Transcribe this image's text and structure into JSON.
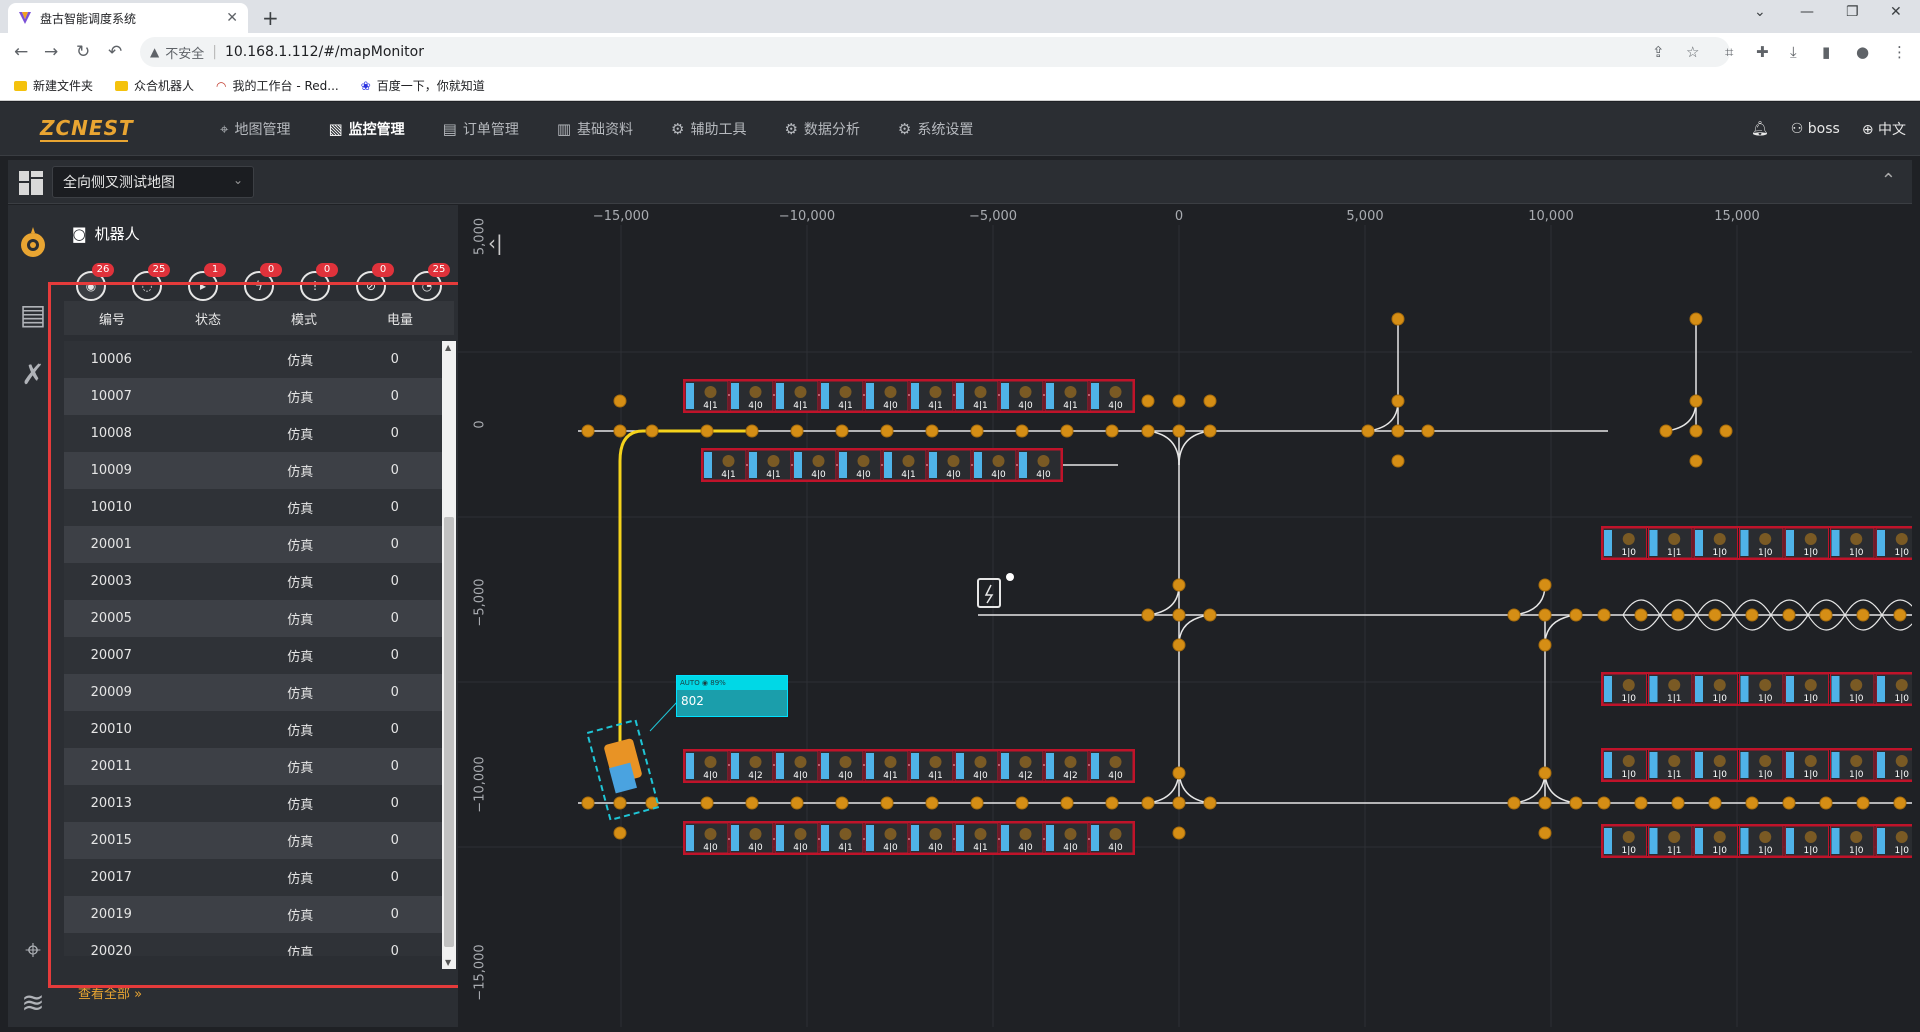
{
  "browser": {
    "tab_title": "盘古智能调度系统",
    "address_insecure": "不安全",
    "address_url": "10.168.1.112/#/mapMonitor",
    "bookmarks": [
      "新建文件夹",
      "众合机器人",
      "我的工作台 - Red...",
      "百度一下，你就知道"
    ]
  },
  "app": {
    "logo": "ZCNEST",
    "menu": [
      {
        "label": "地图管理",
        "icon": "map-pin-icon"
      },
      {
        "label": "监控管理",
        "icon": "chart-icon",
        "active": true
      },
      {
        "label": "订单管理",
        "icon": "document-icon"
      },
      {
        "label": "基础资料",
        "icon": "sliders-icon"
      },
      {
        "label": "辅助工具",
        "icon": "gear-icon"
      },
      {
        "label": "数据分析",
        "icon": "gear-icon"
      },
      {
        "label": "系统设置",
        "icon": "gear-icon"
      }
    ],
    "user": "boss",
    "language": "中文"
  },
  "toolbar": {
    "map_name": "全向侧叉测试地图"
  },
  "panel": {
    "title": "机器人",
    "filter_badges": [
      "26",
      "25",
      "1",
      "0",
      "0",
      "0",
      "25"
    ],
    "columns": [
      "编号",
      "状态",
      "模式",
      "电量"
    ],
    "rows": [
      {
        "id": "10006",
        "status": "",
        "mode": "仿真",
        "battery": "0"
      },
      {
        "id": "10007",
        "status": "",
        "mode": "仿真",
        "battery": "0"
      },
      {
        "id": "10008",
        "status": "",
        "mode": "仿真",
        "battery": "0"
      },
      {
        "id": "10009",
        "status": "",
        "mode": "仿真",
        "battery": "0"
      },
      {
        "id": "10010",
        "status": "",
        "mode": "仿真",
        "battery": "0"
      },
      {
        "id": "20001",
        "status": "",
        "mode": "仿真",
        "battery": "0"
      },
      {
        "id": "20003",
        "status": "",
        "mode": "仿真",
        "battery": "0"
      },
      {
        "id": "20005",
        "status": "",
        "mode": "仿真",
        "battery": "0"
      },
      {
        "id": "20007",
        "status": "",
        "mode": "仿真",
        "battery": "0"
      },
      {
        "id": "20009",
        "status": "",
        "mode": "仿真",
        "battery": "0"
      },
      {
        "id": "20010",
        "status": "",
        "mode": "仿真",
        "battery": "0"
      },
      {
        "id": "20011",
        "status": "",
        "mode": "仿真",
        "battery": "0"
      },
      {
        "id": "20013",
        "status": "",
        "mode": "仿真",
        "battery": "0"
      },
      {
        "id": "20015",
        "status": "",
        "mode": "仿真",
        "battery": "0"
      },
      {
        "id": "20017",
        "status": "",
        "mode": "仿真",
        "battery": "0"
      },
      {
        "id": "20019",
        "status": "",
        "mode": "仿真",
        "battery": "0"
      },
      {
        "id": "20020",
        "status": "",
        "mode": "仿真",
        "battery": "0"
      }
    ],
    "view_all": "查看全部 »"
  },
  "map": {
    "x_ticks": [
      "−15,000",
      "−10,000",
      "−5,000",
      "0",
      "5,000",
      "10,000",
      "15,000"
    ],
    "y_ticks": [
      "5,000",
      "0",
      "−5,000",
      "−10,000",
      "−15,000"
    ],
    "robot_card": {
      "status": "AUTO  ◉  89%",
      "name": "802"
    },
    "top_shelf_labels": [
      "4|1",
      "4|0",
      "4|1",
      "4|1",
      "4|0",
      "4|1",
      "4|1",
      "4|0",
      "4|1",
      "4|0"
    ],
    "mid_shelf_labels": [
      "4|1",
      "4|1",
      "4|0",
      "4|0",
      "4|1",
      "4|0",
      "4|0",
      "4|0"
    ],
    "low_shelf_labels": [
      "4|0",
      "4|2",
      "4|0",
      "4|0",
      "4|1",
      "4|1",
      "4|0",
      "4|2",
      "4|2",
      "4|0"
    ],
    "bottom_shelf_labels": [
      "4|0",
      "4|0",
      "4|0",
      "4|1",
      "4|0",
      "4|0",
      "4|1",
      "4|0",
      "4|0",
      "4|0"
    ],
    "right_shelf_labels": [
      "1|0",
      "1|1",
      "1|0",
      "1|0",
      "1|0",
      "1|0",
      "1|0"
    ]
  },
  "colors": {
    "accent": "#e9a532",
    "alert": "#e0323b",
    "highlight_box": "#e53b3b",
    "shelf_border": "#c0132a",
    "slot_blue": "#4fb3e8",
    "path_yellow": "#f5d31c"
  }
}
